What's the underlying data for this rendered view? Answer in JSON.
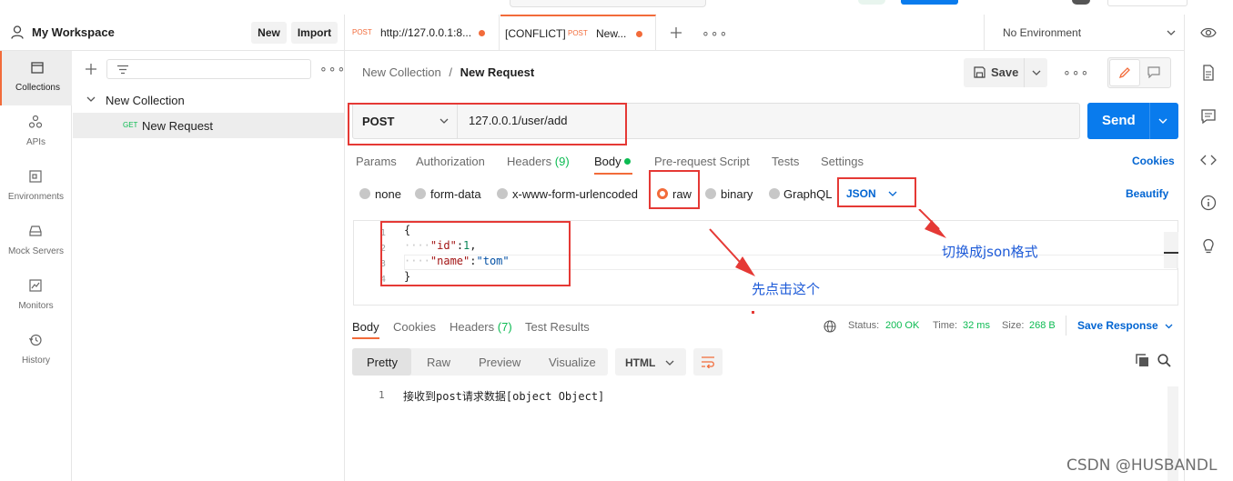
{
  "workspace": {
    "name": "My Workspace",
    "new_label": "New",
    "import_label": "Import"
  },
  "sidebar": {
    "items": [
      {
        "id": "collections",
        "label": "Collections",
        "icon": "collections-icon",
        "active": true
      },
      {
        "id": "apis",
        "label": "APIs",
        "icon": "apis-icon",
        "active": false
      },
      {
        "id": "environments",
        "label": "Environments",
        "icon": "environments-icon",
        "active": false
      },
      {
        "id": "mock-servers",
        "label": "Mock Servers",
        "icon": "mock-servers-icon",
        "active": false
      },
      {
        "id": "monitors",
        "label": "Monitors",
        "icon": "monitors-icon",
        "active": false
      },
      {
        "id": "history",
        "label": "History",
        "icon": "history-icon",
        "active": false
      }
    ]
  },
  "collections": {
    "tree": [
      {
        "name": "New Collection",
        "children": [
          {
            "method": "GET",
            "name": "New Request"
          }
        ]
      }
    ]
  },
  "tabs": [
    {
      "method": "POST",
      "title": "http://127.0.0.1:8...",
      "prefix": ""
    },
    {
      "method": "POST",
      "title": "New...",
      "prefix": "[CONFLICT]"
    }
  ],
  "environment": {
    "selected": "No Environment"
  },
  "breadcrumb": {
    "parent": "New Collection",
    "separator": "/",
    "current": "New Request"
  },
  "toolbar": {
    "save_label": "Save"
  },
  "request": {
    "method": "POST",
    "url": "127.0.0.1/user/add",
    "send_label": "Send"
  },
  "request_tabs": {
    "params": "Params",
    "authorization": "Authorization",
    "headers": "Headers",
    "headers_count": "(9)",
    "body": "Body",
    "prerequest": "Pre-request Script",
    "tests": "Tests",
    "settings": "Settings",
    "cookies": "Cookies"
  },
  "body_options": {
    "none": "none",
    "form_data": "form-data",
    "urlencoded": "x-www-form-urlencoded",
    "raw": "raw",
    "binary": "binary",
    "graphql": "GraphQL",
    "format": "JSON",
    "beautify": "Beautify",
    "selected": "raw"
  },
  "code_editor": {
    "line_numbers": [
      "1",
      "2",
      "3",
      "4"
    ],
    "lines": [
      {
        "text": "{"
      },
      {
        "key": "\"id\"",
        "value": "1",
        "tail": ","
      },
      {
        "key": "\"name\"",
        "value": "\"tom\"",
        "tail": ""
      },
      {
        "text": "}"
      }
    ]
  },
  "annotations": {
    "click_this": "先点击这个",
    "switch_json": "切换成json格式"
  },
  "response": {
    "tabs": {
      "body": "Body",
      "cookies": "Cookies",
      "headers": "Headers",
      "headers_count": "(7)",
      "test_results": "Test Results"
    },
    "status_label": "Status:",
    "status_value": "200 OK",
    "time_label": "Time:",
    "time_value": "32 ms",
    "size_label": "Size:",
    "size_value": "268 B",
    "save_response": "Save Response",
    "views": {
      "pretty": "Pretty",
      "raw": "Raw",
      "preview": "Preview",
      "visualize": "Visualize"
    },
    "format": "HTML",
    "line_number": "1",
    "content": "接收到post请求数据[object Object]"
  },
  "watermark": "CSDN @HUSBANDL",
  "colors": {
    "accent": "#f26b3a",
    "send": "#097bed",
    "link": "#0265d2",
    "status_ok": "#0cbb52",
    "annotation": "#1e5bd8",
    "highlight": "#e53935"
  }
}
